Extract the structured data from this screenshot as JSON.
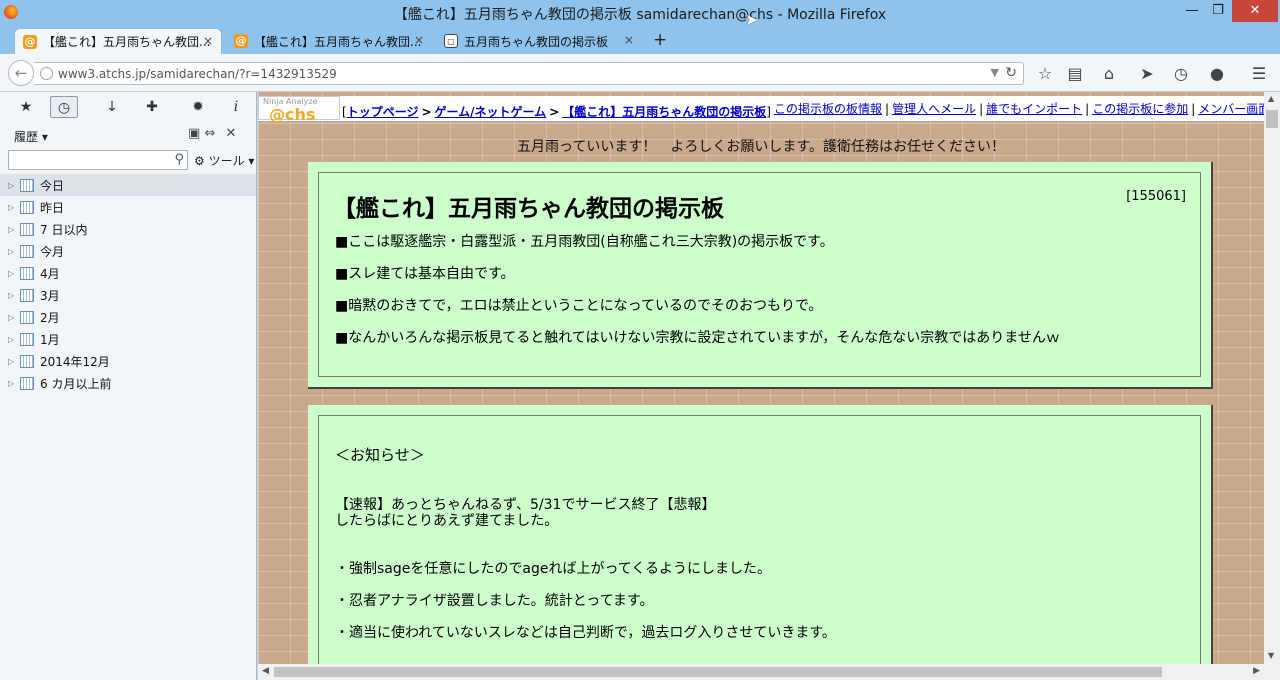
{
  "window": {
    "title": "【艦これ】五月雨ちゃん教団の掲示板 samidarechan@chs - Mozilla Firefox",
    "min": "—",
    "max": "❐",
    "close": "✕"
  },
  "tabs": [
    {
      "label": "【艦これ】五月雨ちゃん教団...",
      "icon": "at-icon",
      "active": true
    },
    {
      "label": "【艦これ】五月雨ちゃん教団...",
      "icon": "at-icon",
      "active": false
    },
    {
      "label": "五月雨ちゃん教団の掲示板",
      "icon": "board-icon",
      "active": false
    }
  ],
  "tab_close": "×",
  "new_tab": "+",
  "address": {
    "url": "www3.atchs.jp/samidarechan/?r=1432913529"
  },
  "sidebar": {
    "heading": "履歴 ▾",
    "tools": "ツール ▾",
    "search_placeholder": "",
    "items": [
      {
        "label": "今日"
      },
      {
        "label": "昨日"
      },
      {
        "label": "7 日以内"
      },
      {
        "label": "今月"
      },
      {
        "label": "4月"
      },
      {
        "label": "3月"
      },
      {
        "label": "2月"
      },
      {
        "label": "1月"
      },
      {
        "label": "2014年12月"
      },
      {
        "label": "6 カ月以上前"
      }
    ]
  },
  "page": {
    "logo_small": "Ninja Analyze",
    "logo_text": "@chs",
    "crumbs": {
      "open": "[",
      "top": "トップページ",
      "sep": ">",
      "cat": "ゲーム/ネットゲーム",
      "board": "【艦これ】五月雨ちゃん教団の掲示板",
      "close": "]"
    },
    "links": [
      "この掲示板の板情報",
      "管理人へメール",
      "誰でもインポート",
      "この掲示板に参加",
      "メンバー画面"
    ],
    "link_sep": "|",
    "tagline": "五月雨っていいます！　よろしくお願いします。護衛任務はお任せください！",
    "board_title": "【艦これ】五月雨ちゃん教団の掲示板",
    "thread_count": "[155061]",
    "rules": [
      "■ここは駆逐艦宗・白露型派・五月雨教団(自称艦これ三大宗教)の掲示板です。",
      "■スレ建ては基本自由です。",
      "■暗黙のおきてで，エロは禁止ということになっているのでそのおつもりで。",
      "■なんかいろんな掲示板見てると触れてはいけない宗教に設定されていますが，そんな危ない宗教ではありませんｗ"
    ],
    "notice_head": "＜お知らせ＞",
    "notices": [
      "【速報】あっとちゃんねるず、5/31でサービス終了【悲報】",
      "したらばにとりあえず建てました。",
      "・強制sageを任意にしたのでageれば上がってくるようにしました。",
      "・忍者アナライザ設置しました。統計とってます。",
      "・適当に使われていないスレなどは自己判断で，過去ログ入りさせていきます。"
    ]
  }
}
